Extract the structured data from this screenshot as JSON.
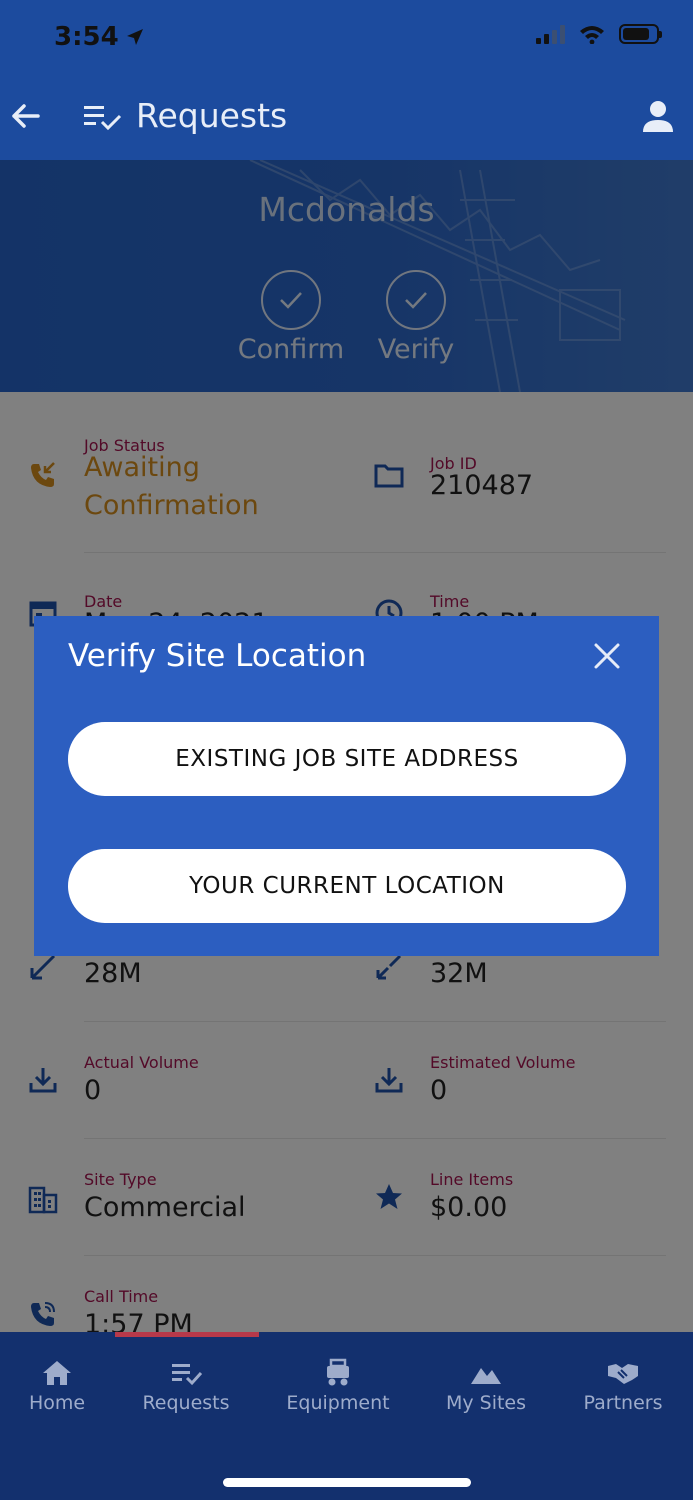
{
  "status_bar": {
    "time": "3:54"
  },
  "app_bar": {
    "title": "Requests"
  },
  "hero": {
    "title": "Mcdonalds",
    "steps": [
      {
        "label": "Confirm"
      },
      {
        "label": "Verify"
      }
    ]
  },
  "details": {
    "job_status": {
      "label": "Job Status",
      "value_line1": "Awaiting",
      "value_line2": "Confirmation"
    },
    "job_id": {
      "label": "Job ID",
      "value": "210487"
    },
    "date": {
      "label": "Date",
      "value": "May 24, 2021"
    },
    "time": {
      "label": "Time",
      "value": "1:00 PM"
    },
    "left_measure": {
      "value": "28M"
    },
    "right_measure": {
      "value": "32M"
    },
    "actual_volume": {
      "label": "Actual Volume",
      "value": "0"
    },
    "estimated_volume": {
      "label": "Estimated Volume",
      "value": "0"
    },
    "site_type": {
      "label": "Site Type",
      "value": "Commercial"
    },
    "line_items": {
      "label": "Line Items",
      "value": "$0.00"
    },
    "call_time": {
      "label": "Call Time",
      "value": "1:57 PM"
    }
  },
  "dialog": {
    "title": "Verify Site Location",
    "option_existing": "EXISTING JOB SITE ADDRESS",
    "option_current": "YOUR CURRENT LOCATION"
  },
  "bottom_nav": {
    "items": [
      {
        "label": "Home",
        "icon": "home-icon"
      },
      {
        "label": "Requests",
        "icon": "list-check-icon"
      },
      {
        "label": "Equipment",
        "icon": "equipment-icon"
      },
      {
        "label": "My Sites",
        "icon": "mountains-icon"
      },
      {
        "label": "Partners",
        "icon": "handshake-icon"
      }
    ],
    "active_index": 1
  },
  "colors": {
    "app_bar": "#1c4b9e",
    "hero": "#2b66c6",
    "dialog": "#2c5ec0",
    "label_accent": "#a0144e",
    "status_accent": "#d08a1e",
    "bottom_nav": "#13306e"
  }
}
